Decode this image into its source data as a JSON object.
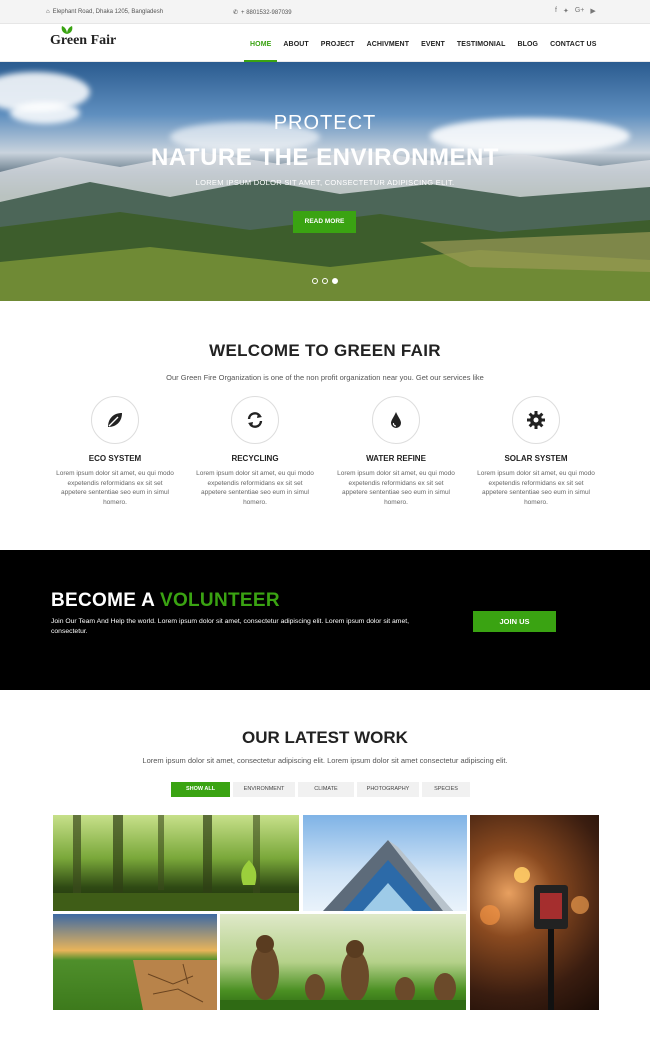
{
  "topbar": {
    "address": "Elephant Road, Dhaka 1205, Bangladesh",
    "phone": "+ 8801532-987039"
  },
  "nav": {
    "logo": "Green Fair",
    "items": [
      "HOME",
      "ABOUT",
      "PROJECT",
      "ACHIVMENT",
      "EVENT",
      "TESTIMONIAL",
      "BLOG",
      "CONTACT US"
    ],
    "active": "HOME"
  },
  "hero": {
    "line1": "PROTECT",
    "line2": "NATURE THE ENVIRONMENT",
    "subtitle": "LOREM IPSUM DOLOR SIT AMET, CONSECTETUR ADIPISCING ELIT.",
    "button": "READ MORE",
    "slide_count": 3,
    "active_slide": 3
  },
  "welcome": {
    "title": "WELCOME TO GREEN FAIR",
    "subtitle": "Our Green Fire Organization is one of the non profit organization near you. Get our services like",
    "features": [
      {
        "title": "ECO SYSTEM",
        "icon": "leaf-icon",
        "text": "Lorem ipsum dolor sit amet, eu qui modo expetendis reformidans ex sit set appetere sententiae seo eum in simul homero."
      },
      {
        "title": "RECYCLING",
        "icon": "recycle-icon",
        "text": "Lorem ipsum dolor sit amet, eu qui modo expetendis reformidans ex sit set appetere sententiae seo eum in simul homero."
      },
      {
        "title": "WATER REFINE",
        "icon": "water-drop-icon",
        "text": "Lorem ipsum dolor sit amet, eu qui modo expetendis reformidans ex sit set appetere sententiae seo eum in simul homero."
      },
      {
        "title": "SOLAR SYSTEM",
        "icon": "gear-icon",
        "text": "Lorem ipsum dolor sit amet, eu qui modo expetendis reformidans ex sit set appetere sententiae seo eum in simul homero."
      }
    ]
  },
  "volunteer": {
    "title_white": "BECOME A ",
    "title_green": "VOLUNTEER",
    "text": "Join Our Team And Help the world. Lorem ipsum dolor sit amet, consectetur adipiscing elit. Lorem ipsum dolor sit amet, consectetur.",
    "button": "JOIN US"
  },
  "work": {
    "title": "OUR LATEST WORK",
    "subtitle": "Lorem ipsum dolor sit amet, consectetur adipiscing elit. Lorem ipsum dolor sit amet consectetur adipiscing elit.",
    "filters": [
      "SHOW ALL",
      "ENVIRONMENT",
      "CLIMATE",
      "PHOTOGRAPHY",
      "SPECIES"
    ],
    "active_filter": "SHOW ALL"
  },
  "colors": {
    "accent": "#3aa312",
    "dark": "#000000"
  }
}
